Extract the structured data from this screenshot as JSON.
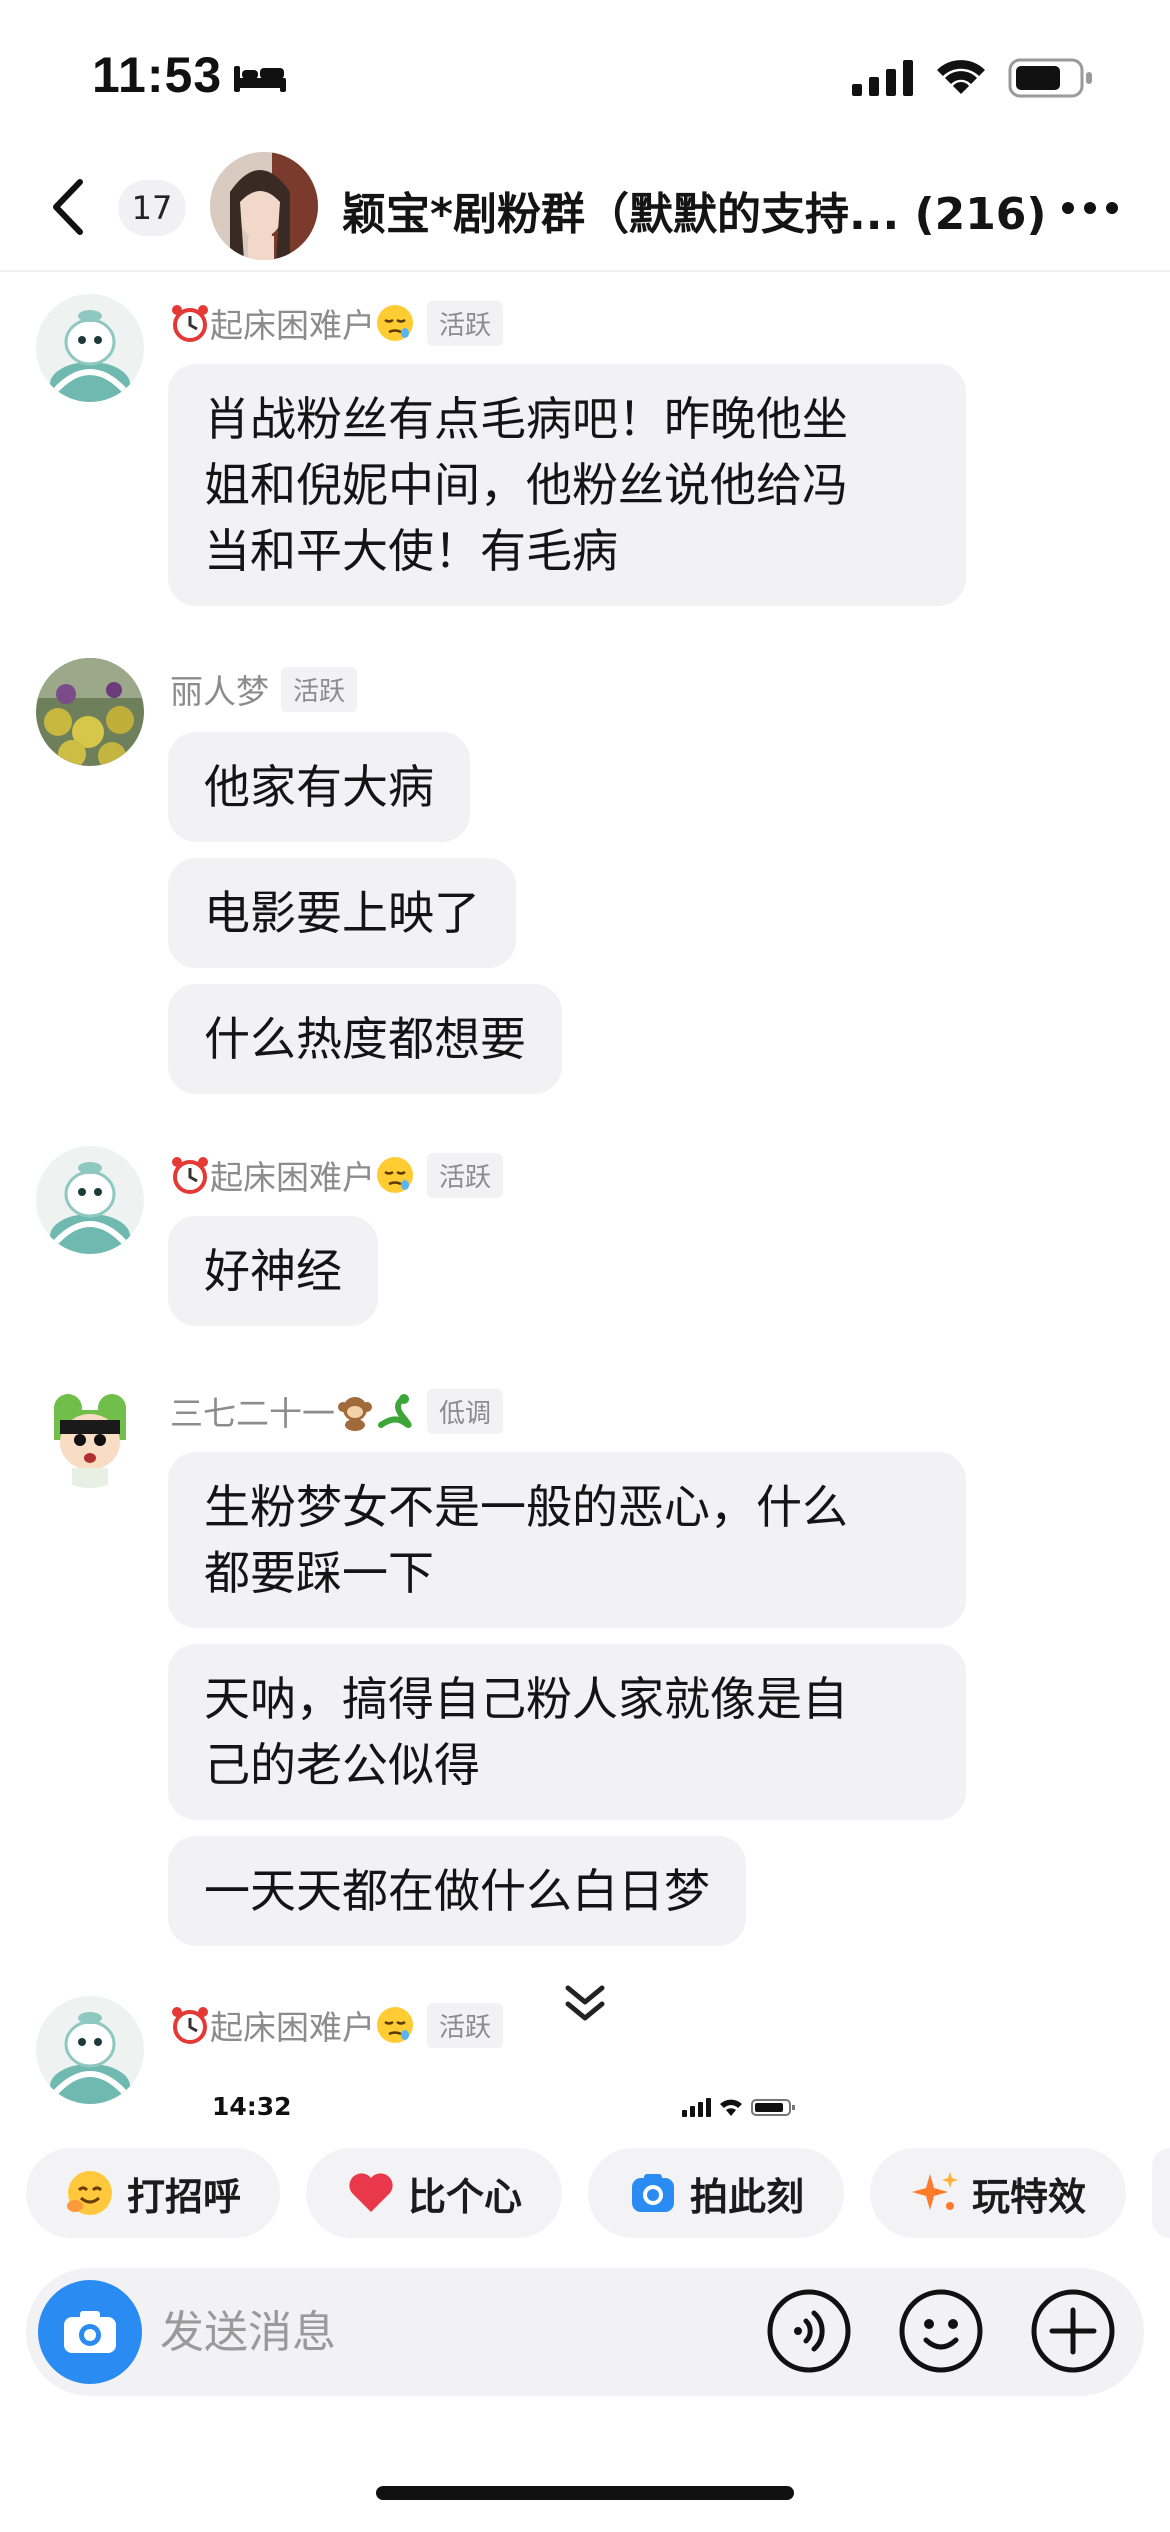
{
  "status_bar": {
    "time": "11:53"
  },
  "header": {
    "unread_count": "17",
    "group_title": "颖宝*剧粉群（默默的支持... (216)"
  },
  "messages": [
    {
      "sender": "起床困难户",
      "badge": "活跃",
      "bubbles": [
        "肖战粉丝有点毛病吧！昨晚他坐",
        "姐和倪妮中间，他粉丝说他给冯",
        "当和平大使！有毛病"
      ]
    },
    {
      "sender": "丽人梦",
      "badge": "活跃",
      "bubbles": [
        "他家有大病",
        "电影要上映了",
        "什么热度都想要"
      ]
    },
    {
      "sender": "起床困难户",
      "badge": "活跃",
      "bubbles": [
        "好神经"
      ]
    },
    {
      "sender": "三七二十一",
      "badge": "低调",
      "bubbles": [
        "生粉梦女不是一般的恶心，什么",
        "都要踩一下",
        "天呐，搞得自己粉人家就像是自",
        "己的老公似得",
        "一天天都在做什么白日梦"
      ]
    },
    {
      "sender": "起床困难户",
      "badge": "活跃"
    }
  ],
  "embedded_status": {
    "time": "14:32"
  },
  "quick_actions": [
    {
      "label": "打招呼",
      "icon": "greeting-icon"
    },
    {
      "label": "比个心",
      "icon": "heart-icon"
    },
    {
      "label": "拍此刻",
      "icon": "camera-icon"
    },
    {
      "label": "玩特效",
      "icon": "sparkle-icon"
    }
  ],
  "input": {
    "placeholder": "发送消息"
  },
  "colors": {
    "accent_blue": "#2a8cf3",
    "bubble_bg": "#f2f2f5",
    "heart_red": "#e8384a"
  }
}
